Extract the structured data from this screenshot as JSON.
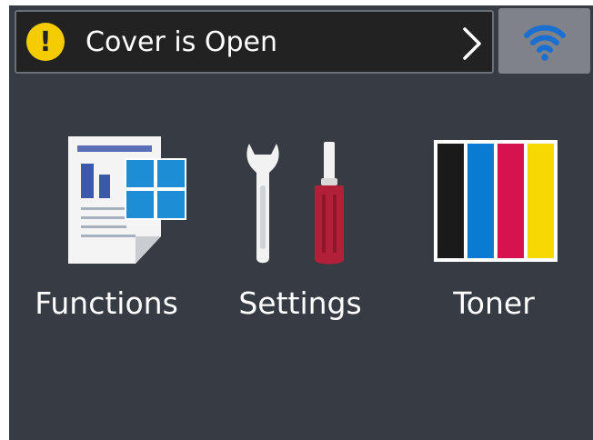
{
  "status": {
    "message": "Cover is Open",
    "level": "warning",
    "warning_color": "#f4cc00",
    "warning_symbol": "!"
  },
  "wifi": {
    "icon": "wifi-icon",
    "accent": "#1a6fd0"
  },
  "tiles": [
    {
      "label": "Functions",
      "icon": "functions-icon"
    },
    {
      "label": "Settings",
      "icon": "settings-icon"
    },
    {
      "label": "Toner",
      "icon": "toner-icon"
    }
  ],
  "toner": {
    "colors": [
      "#1a1a1a",
      "#0a7bd2",
      "#d6124f",
      "#f7d800"
    ],
    "names": [
      "black",
      "cyan",
      "magenta",
      "yellow"
    ]
  }
}
